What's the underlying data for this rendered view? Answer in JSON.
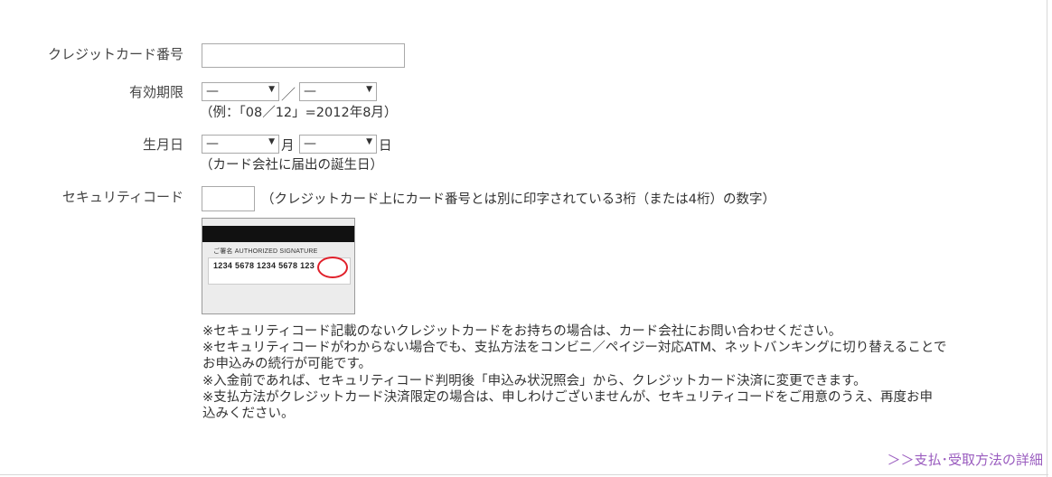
{
  "card_number": {
    "label": "クレジットカード番号",
    "value": ""
  },
  "expiry": {
    "label": "有効期限",
    "month_value": "—",
    "year_value": "—",
    "separator": "／",
    "hint": "（例：「08／12」=2012年8月）"
  },
  "birthday": {
    "label": "生月日",
    "month_value": "—",
    "month_unit": "月",
    "day_value": "—",
    "day_unit": "日",
    "hint": "（カード会社に届出の誕生日）"
  },
  "security_code": {
    "label": "セキュリティコード",
    "value": "",
    "description": "（クレジットカード上にカード番号とは別に印字されている3桁（または4桁）の数字）",
    "card_image": {
      "signature_title": "ご署名 AUTHORIZED SIGNATURE",
      "number_text": "1234 5678 1234 5678 123"
    }
  },
  "notes": [
    "※セキュリティコード記載のないクレジットカードをお持ちの場合は、カード会社にお問い合わせください。",
    "※セキュリティコードがわからない場合でも、支払方法をコンビニ／ペイジー対応ATM、ネットバンキングに切り替えることで",
    "お申込みの続行が可能です。",
    "※入金前であれば、セキュリティコード判明後「申込み状況照会」から、クレジットカード決済に変更できます。",
    "※支払方法がクレジットカード決済限定の場合は、申しわけございませんが、セキュリティコードをご用意のうえ、再度お申",
    "込みください。"
  ],
  "details_link": "＞＞支払･受取方法の詳細"
}
